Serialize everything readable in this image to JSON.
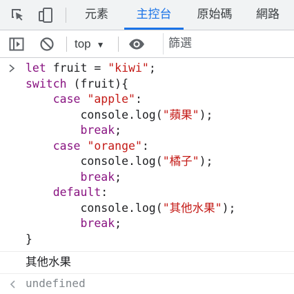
{
  "tabs": [
    {
      "label": "元素"
    },
    {
      "label": "主控台",
      "active": true
    },
    {
      "label": "原始碼"
    },
    {
      "label": "網路"
    }
  ],
  "toolbar": {
    "context": "top",
    "filter_placeholder": "篩選"
  },
  "code_lines": [
    [
      {
        "c": "kw",
        "t": "let"
      },
      {
        "c": "pl",
        "t": " fruit = "
      },
      {
        "c": "str",
        "t": "\"kiwi\""
      },
      {
        "c": "pl",
        "t": ";"
      }
    ],
    [
      {
        "c": "kw",
        "t": "switch"
      },
      {
        "c": "pl",
        "t": " (fruit){"
      }
    ],
    [
      {
        "c": "pl",
        "t": "    "
      },
      {
        "c": "kw",
        "t": "case"
      },
      {
        "c": "pl",
        "t": " "
      },
      {
        "c": "str",
        "t": "\"apple\""
      },
      {
        "c": "pl",
        "t": ":"
      }
    ],
    [
      {
        "c": "pl",
        "t": "        console.log("
      },
      {
        "c": "str",
        "t": "\"蘋果\""
      },
      {
        "c": "pl",
        "t": ");"
      }
    ],
    [
      {
        "c": "pl",
        "t": "        "
      },
      {
        "c": "kw",
        "t": "break"
      },
      {
        "c": "pl",
        "t": ";"
      }
    ],
    [
      {
        "c": "pl",
        "t": "    "
      },
      {
        "c": "kw",
        "t": "case"
      },
      {
        "c": "pl",
        "t": " "
      },
      {
        "c": "str",
        "t": "\"orange\""
      },
      {
        "c": "pl",
        "t": ":"
      }
    ],
    [
      {
        "c": "pl",
        "t": "        console.log("
      },
      {
        "c": "str",
        "t": "\"橘子\""
      },
      {
        "c": "pl",
        "t": ");"
      }
    ],
    [
      {
        "c": "pl",
        "t": "        "
      },
      {
        "c": "kw",
        "t": "break"
      },
      {
        "c": "pl",
        "t": ";"
      }
    ],
    [
      {
        "c": "pl",
        "t": "    "
      },
      {
        "c": "kw",
        "t": "default"
      },
      {
        "c": "pl",
        "t": ":"
      }
    ],
    [
      {
        "c": "pl",
        "t": "        console.log("
      },
      {
        "c": "str",
        "t": "\"其他水果\""
      },
      {
        "c": "pl",
        "t": ");"
      }
    ],
    [
      {
        "c": "pl",
        "t": "        "
      },
      {
        "c": "kw",
        "t": "break"
      },
      {
        "c": "pl",
        "t": ";"
      }
    ],
    [
      {
        "c": "pl",
        "t": "}"
      }
    ]
  ],
  "output": "其他水果",
  "result": "undefined",
  "colors": {
    "accent": "#1a73e8",
    "keyword": "#881280",
    "string": "#c41a16"
  }
}
